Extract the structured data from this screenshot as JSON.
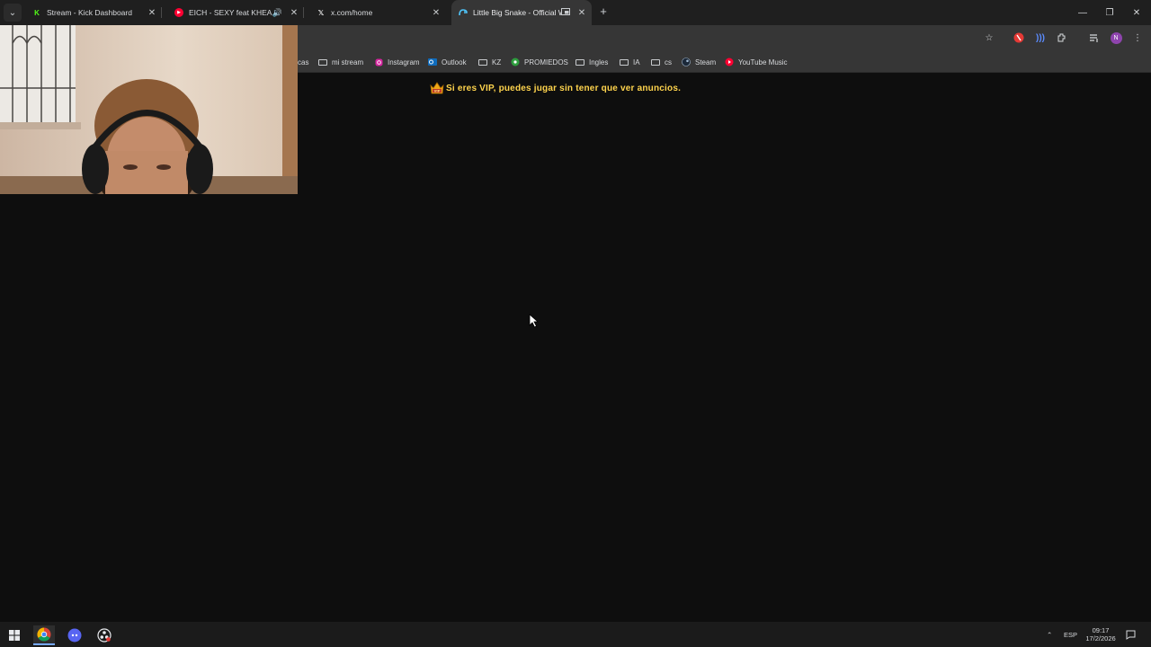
{
  "browser": {
    "tabs": [
      {
        "title": "Stream - Kick Dashboard",
        "favicon": "kick-icon",
        "color": "#53fc18"
      },
      {
        "title": "EICH - SEXY feat KHEA & D",
        "favicon": "youtube-music-icon",
        "color": "#ff0033"
      },
      {
        "title": "x.com/home",
        "favicon": "x-icon",
        "color": "#ffffff"
      },
      {
        "title": "Little Big Snake - Official W",
        "favicon": "snake-icon",
        "color": "#4fc3f7"
      }
    ],
    "bookmarks": [
      {
        "label": "cas",
        "icon": "folder-icon"
      },
      {
        "label": "mi stream",
        "icon": "folder-icon"
      },
      {
        "label": "Instagram",
        "icon": "instagram-icon"
      },
      {
        "label": "Outlook",
        "icon": "outlook-icon"
      },
      {
        "label": "KZ",
        "icon": "folder-icon"
      },
      {
        "label": "PROMIEDOS",
        "icon": "promiedos-icon"
      },
      {
        "label": "Ingles",
        "icon": "folder-icon"
      },
      {
        "label": "IA",
        "icon": "folder-icon"
      },
      {
        "label": "cs",
        "icon": "folder-icon"
      },
      {
        "label": "Steam",
        "icon": "steam-icon"
      },
      {
        "label": "YouTube Music",
        "icon": "youtube-music-icon"
      }
    ],
    "profile_initial": "N"
  },
  "page": {
    "vip_message": "Si eres VIP, puedes jugar sin tener que ver anuncios."
  },
  "taskbar": {
    "language": "ESP",
    "time": "09:17",
    "date": "17/2/2026"
  },
  "colors": {
    "accent_yellow": "#ffd44d",
    "page_bg": "#0e0e0e",
    "toolbar_bg": "#363636"
  }
}
